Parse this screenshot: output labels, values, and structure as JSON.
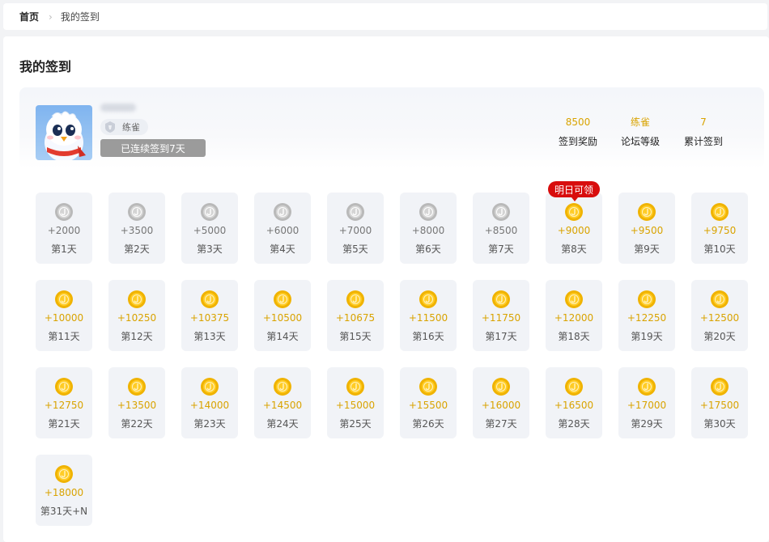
{
  "breadcrumb": {
    "home": "首页",
    "separator": "›",
    "current": "我的签到"
  },
  "page": {
    "title": "我的签到"
  },
  "profile": {
    "username": "ou2020",
    "level_name": "练雀",
    "streak_text": "已连续签到7天"
  },
  "stats": [
    {
      "value": "8500",
      "label": "签到奖励"
    },
    {
      "value": "练雀",
      "label": "论坛等级"
    },
    {
      "value": "7",
      "label": "累计签到"
    }
  ],
  "tomorrow_badge": "明日可领",
  "colors": {
    "gold": "#d9a300",
    "badge_red": "#d80d0d",
    "card_bg": "#f1f3f7"
  },
  "days": [
    {
      "amount": "+2000",
      "label": "第1天",
      "claimed": true
    },
    {
      "amount": "+3500",
      "label": "第2天",
      "claimed": true
    },
    {
      "amount": "+5000",
      "label": "第3天",
      "claimed": true
    },
    {
      "amount": "+6000",
      "label": "第4天",
      "claimed": true
    },
    {
      "amount": "+7000",
      "label": "第5天",
      "claimed": true
    },
    {
      "amount": "+8000",
      "label": "第6天",
      "claimed": true
    },
    {
      "amount": "+8500",
      "label": "第7天",
      "claimed": true
    },
    {
      "amount": "+9000",
      "label": "第8天",
      "claimed": false,
      "tomorrow": true
    },
    {
      "amount": "+9500",
      "label": "第9天",
      "claimed": false
    },
    {
      "amount": "+9750",
      "label": "第10天",
      "claimed": false
    },
    {
      "amount": "+10000",
      "label": "第11天",
      "claimed": false
    },
    {
      "amount": "+10250",
      "label": "第12天",
      "claimed": false
    },
    {
      "amount": "+10375",
      "label": "第13天",
      "claimed": false
    },
    {
      "amount": "+10500",
      "label": "第14天",
      "claimed": false
    },
    {
      "amount": "+10675",
      "label": "第15天",
      "claimed": false
    },
    {
      "amount": "+11500",
      "label": "第16天",
      "claimed": false
    },
    {
      "amount": "+11750",
      "label": "第17天",
      "claimed": false
    },
    {
      "amount": "+12000",
      "label": "第18天",
      "claimed": false
    },
    {
      "amount": "+12250",
      "label": "第19天",
      "claimed": false
    },
    {
      "amount": "+12500",
      "label": "第20天",
      "claimed": false
    },
    {
      "amount": "+12750",
      "label": "第21天",
      "claimed": false
    },
    {
      "amount": "+13500",
      "label": "第22天",
      "claimed": false
    },
    {
      "amount": "+14000",
      "label": "第23天",
      "claimed": false
    },
    {
      "amount": "+14500",
      "label": "第24天",
      "claimed": false
    },
    {
      "amount": "+15000",
      "label": "第25天",
      "claimed": false
    },
    {
      "amount": "+15500",
      "label": "第26天",
      "claimed": false
    },
    {
      "amount": "+16000",
      "label": "第27天",
      "claimed": false
    },
    {
      "amount": "+16500",
      "label": "第28天",
      "claimed": false
    },
    {
      "amount": "+17000",
      "label": "第29天",
      "claimed": false
    },
    {
      "amount": "+17500",
      "label": "第30天",
      "claimed": false
    },
    {
      "amount": "+18000",
      "label": "第31天+N",
      "claimed": false
    }
  ]
}
